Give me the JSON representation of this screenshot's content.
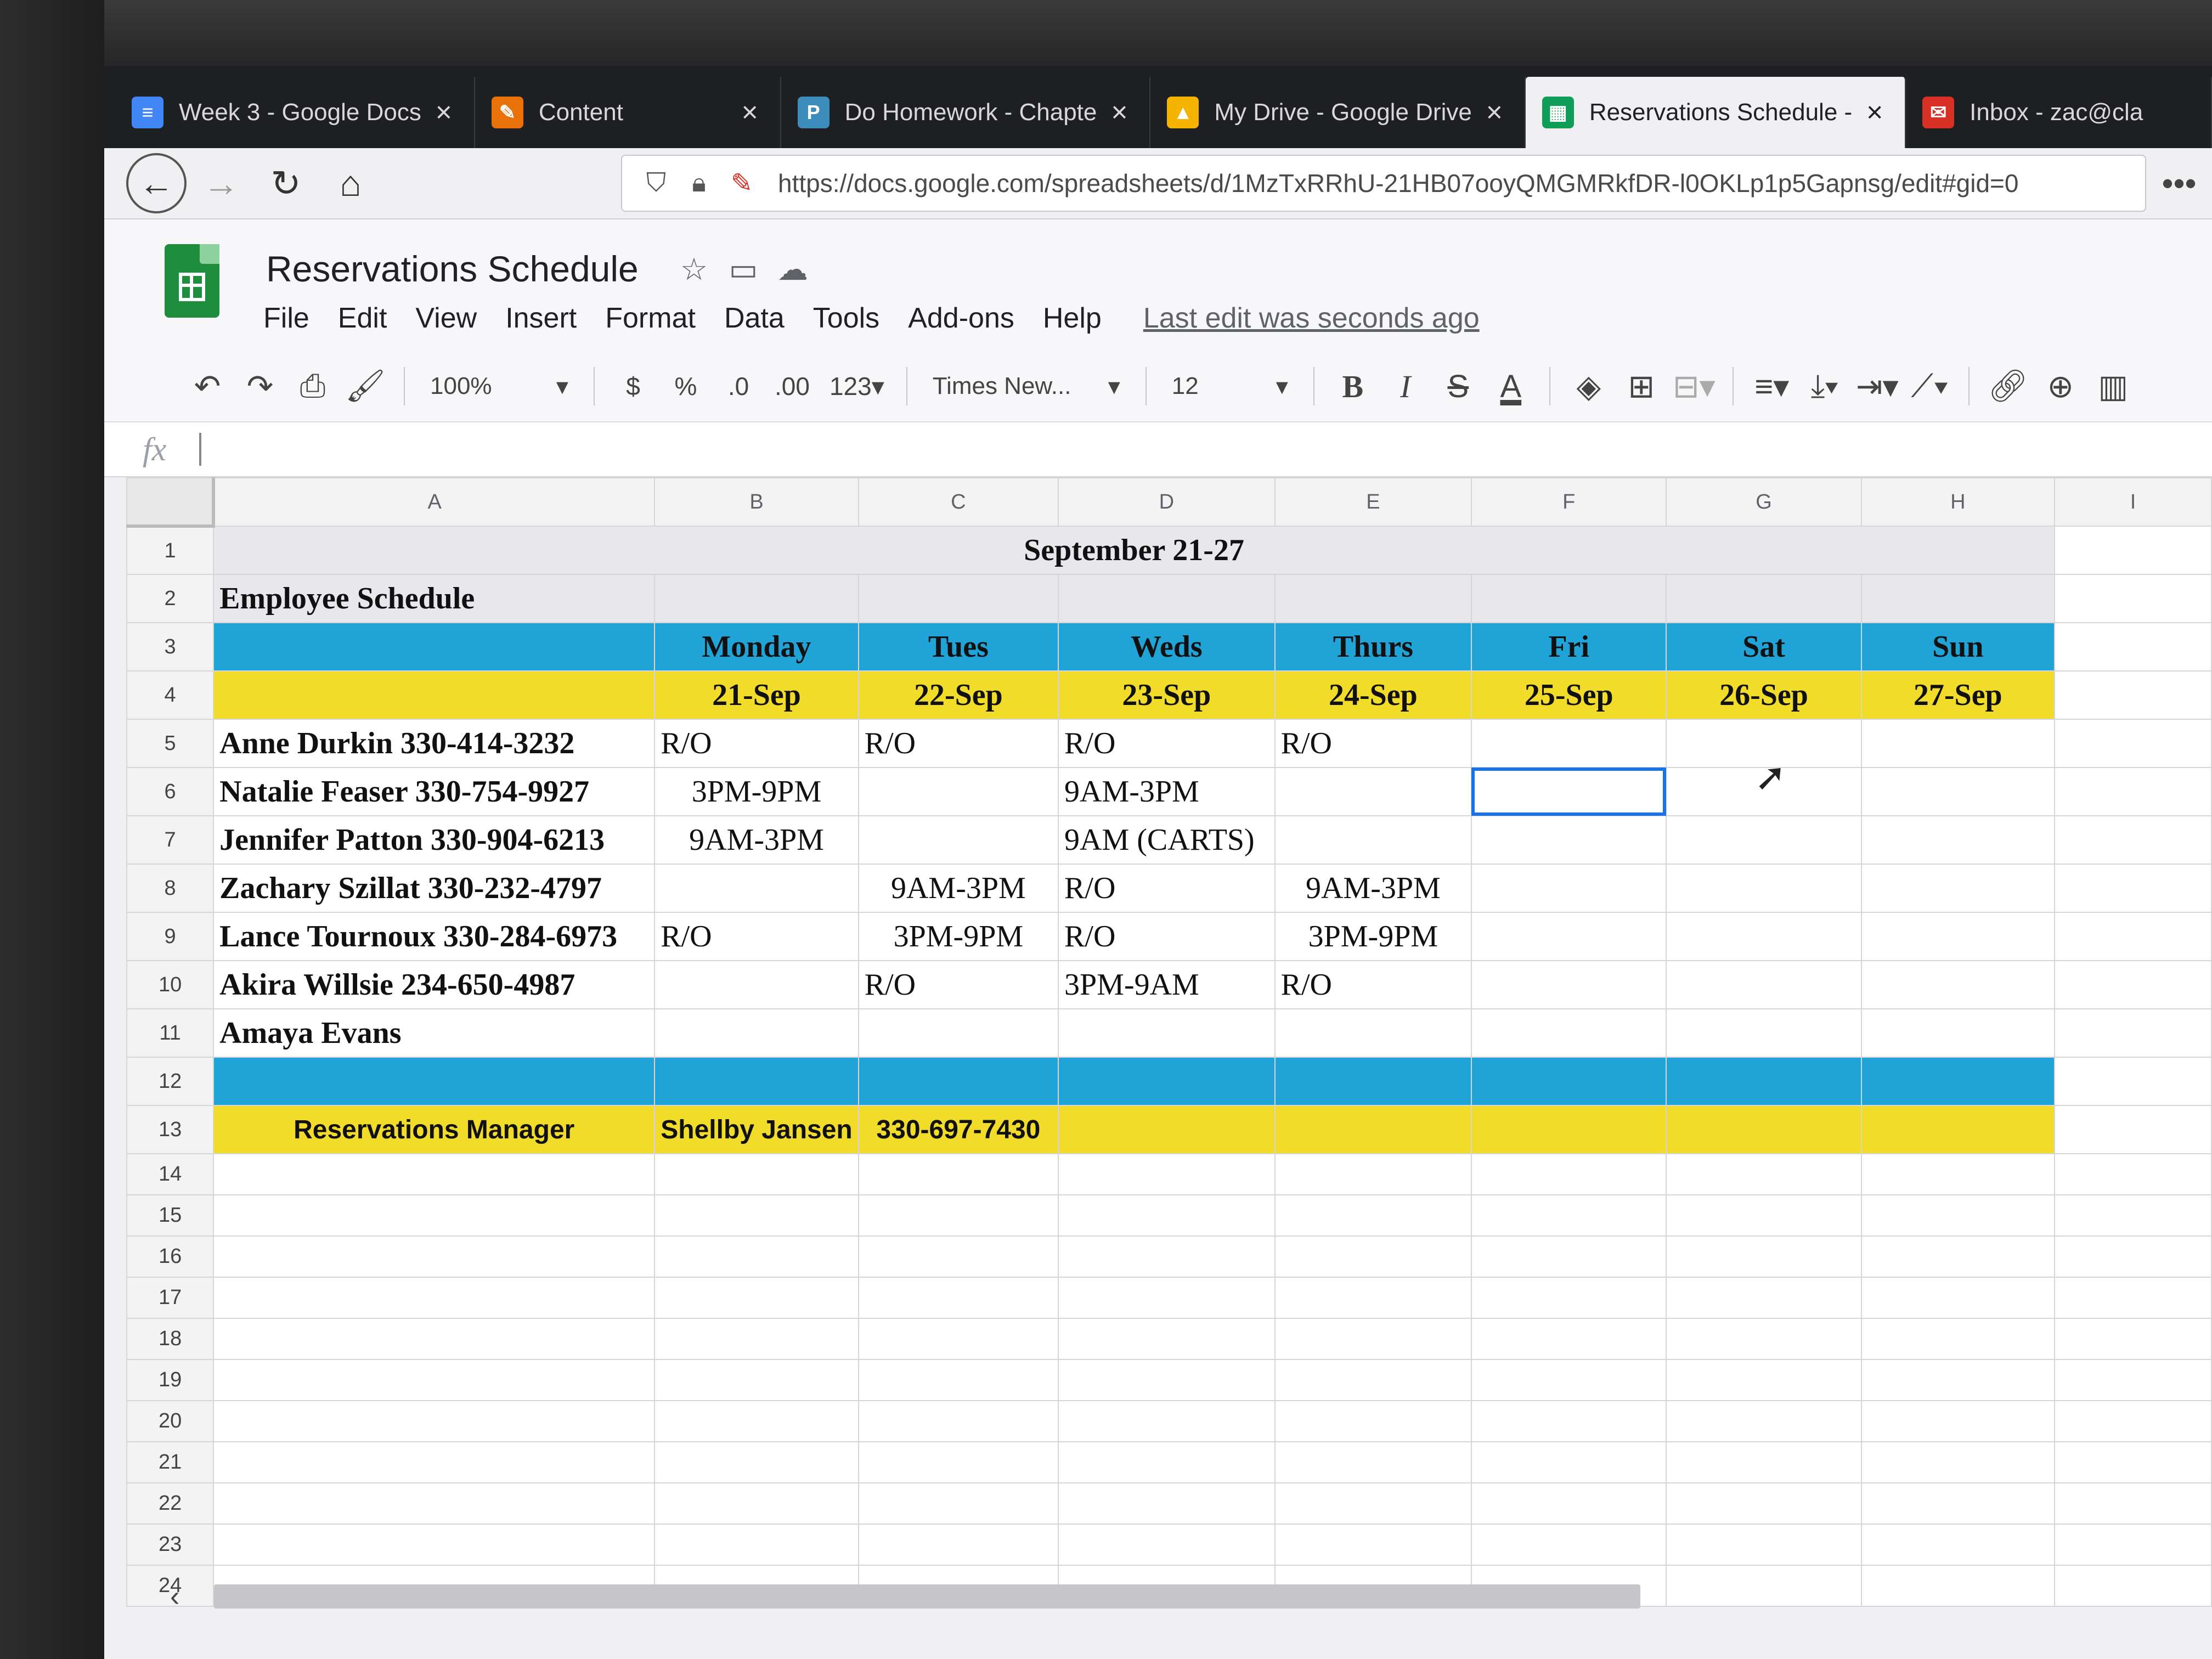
{
  "tabs": [
    {
      "title": "Week 3 - Google Docs",
      "icon": "docs-icon",
      "color": "#4285f4",
      "glyph": "≡"
    },
    {
      "title": "Content",
      "icon": "edit-pencil-icon",
      "color": "#e8710a",
      "glyph": "✎"
    },
    {
      "title": "Do Homework - Chapte",
      "icon": "pearson-icon",
      "color": "#3c8dbc",
      "glyph": "P"
    },
    {
      "title": "My Drive - Google Drive",
      "icon": "drive-icon",
      "color": "#f4b400",
      "glyph": "▲"
    },
    {
      "title": "Reservations Schedule -",
      "icon": "sheets-icon",
      "color": "#0f9d58",
      "glyph": "▦",
      "active": true
    },
    {
      "title": "Inbox - zac@cla",
      "icon": "mail-icon",
      "color": "#d93025",
      "glyph": "✉"
    }
  ],
  "nav": {
    "url": "https://docs.google.com/spreadsheets/d/1MzTxRRhU-21HB07ooyQMGMRkfDR-l0OKLp1p5Gapnsg/edit#gid=0"
  },
  "doc": {
    "title": "Reservations Schedule",
    "menus": [
      "File",
      "Edit",
      "View",
      "Insert",
      "Format",
      "Data",
      "Tools",
      "Add-ons",
      "Help"
    ],
    "last_edit": "Last edit was seconds ago"
  },
  "toolbar": {
    "zoom": "100%",
    "currency": "$",
    "percent": "%",
    "dec_decrease": ".0",
    "dec_increase": ".00",
    "more_formats": "123",
    "font": "Times New...",
    "font_size": "12",
    "bold": "B",
    "italic": "I",
    "strike": "S",
    "text_color": "A"
  },
  "formula": {
    "fx": "fx",
    "value": ""
  },
  "sheet": {
    "columns": [
      "A",
      "B",
      "C",
      "D",
      "E",
      "F",
      "G",
      "H",
      "I"
    ],
    "row_numbers": [
      "1",
      "2",
      "3",
      "4",
      "5",
      "6",
      "7",
      "8",
      "9",
      "10",
      "11",
      "12",
      "13",
      "14",
      "15",
      "16",
      "17",
      "18",
      "19",
      "20",
      "21",
      "22",
      "23",
      "24"
    ],
    "title": "September 21-27",
    "heading": "Employee Schedule",
    "days": [
      "Monday",
      "Tues",
      "Weds",
      "Thurs",
      "Fri",
      "Sat",
      "Sun"
    ],
    "dates": [
      "21-Sep",
      "22-Sep",
      "23-Sep",
      "24-Sep",
      "25-Sep",
      "26-Sep",
      "27-Sep"
    ],
    "employees": [
      {
        "name": "Anne Durkin 330-414-3232",
        "shifts": [
          "R/O",
          "R/O",
          "R/O",
          "R/O",
          "",
          "",
          ""
        ]
      },
      {
        "name": "Natalie Feaser 330-754-9927",
        "shifts": [
          "3PM-9PM",
          "",
          "9AM-3PM",
          "",
          "",
          "",
          ""
        ]
      },
      {
        "name": "Jennifer Patton 330-904-6213",
        "shifts": [
          "9AM-3PM",
          "",
          "9AM (CARTS)",
          "",
          "",
          "",
          ""
        ]
      },
      {
        "name": "Zachary Szillat 330-232-4797",
        "shifts": [
          "",
          "9AM-3PM",
          "R/O",
          "9AM-3PM",
          "",
          "",
          ""
        ]
      },
      {
        "name": "Lance Tournoux 330-284-6973",
        "shifts": [
          "R/O",
          "3PM-9PM",
          "R/O",
          "3PM-9PM",
          "",
          "",
          ""
        ]
      },
      {
        "name": "Akira Willsie 234-650-4987",
        "shifts": [
          "",
          "R/O",
          "3PM-9AM",
          "R/O",
          "",
          "",
          ""
        ]
      },
      {
        "name": "Amaya Evans",
        "shifts": [
          "",
          "",
          "",
          "",
          "",
          "",
          ""
        ]
      }
    ],
    "manager_label": "Reservations Manager",
    "manager_name": "Shellby Jansen",
    "manager_phone": "330-697-7430"
  },
  "colors": {
    "blue_band": "#20a4d8",
    "yellow_band": "#f2dc2a",
    "selection": "#1a73e8"
  }
}
